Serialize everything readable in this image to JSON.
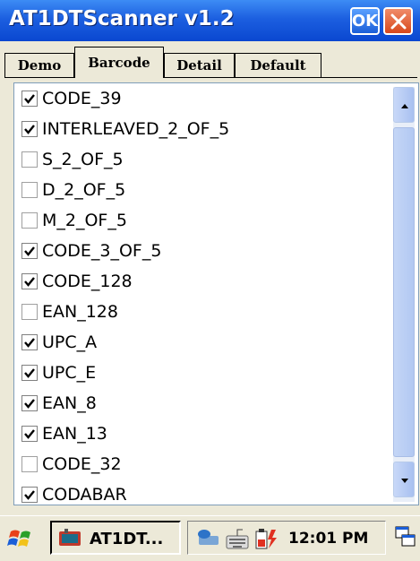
{
  "window": {
    "title": "AT1DTScanner v1.2",
    "ok_label": "OK"
  },
  "tabs": [
    {
      "label": "Demo",
      "active": false
    },
    {
      "label": "Barcode",
      "active": true
    },
    {
      "label": "Detail",
      "active": false
    },
    {
      "label": "Default",
      "active": false
    }
  ],
  "barcodes": [
    {
      "label": "CODE_39",
      "checked": true
    },
    {
      "label": "INTERLEAVED_2_OF_5",
      "checked": true
    },
    {
      "label": "S_2_OF_5",
      "checked": false
    },
    {
      "label": "D_2_OF_5",
      "checked": false
    },
    {
      "label": "M_2_OF_5",
      "checked": false
    },
    {
      "label": "CODE_3_OF_5",
      "checked": true
    },
    {
      "label": "CODE_128",
      "checked": true
    },
    {
      "label": "EAN_128",
      "checked": false
    },
    {
      "label": "UPC_A",
      "checked": true
    },
    {
      "label": "UPC_E",
      "checked": true
    },
    {
      "label": "EAN_8",
      "checked": true
    },
    {
      "label": "EAN_13",
      "checked": true
    },
    {
      "label": "CODE_32",
      "checked": false
    },
    {
      "label": "CODABAR",
      "checked": true
    }
  ],
  "taskbar": {
    "task_label": "AT1DT...",
    "clock": "12:01 PM",
    "icons": [
      "windows-start-icon",
      "app-icon",
      "network-icon",
      "keyboard-icon",
      "battery-icon",
      "desktop-icon"
    ]
  }
}
